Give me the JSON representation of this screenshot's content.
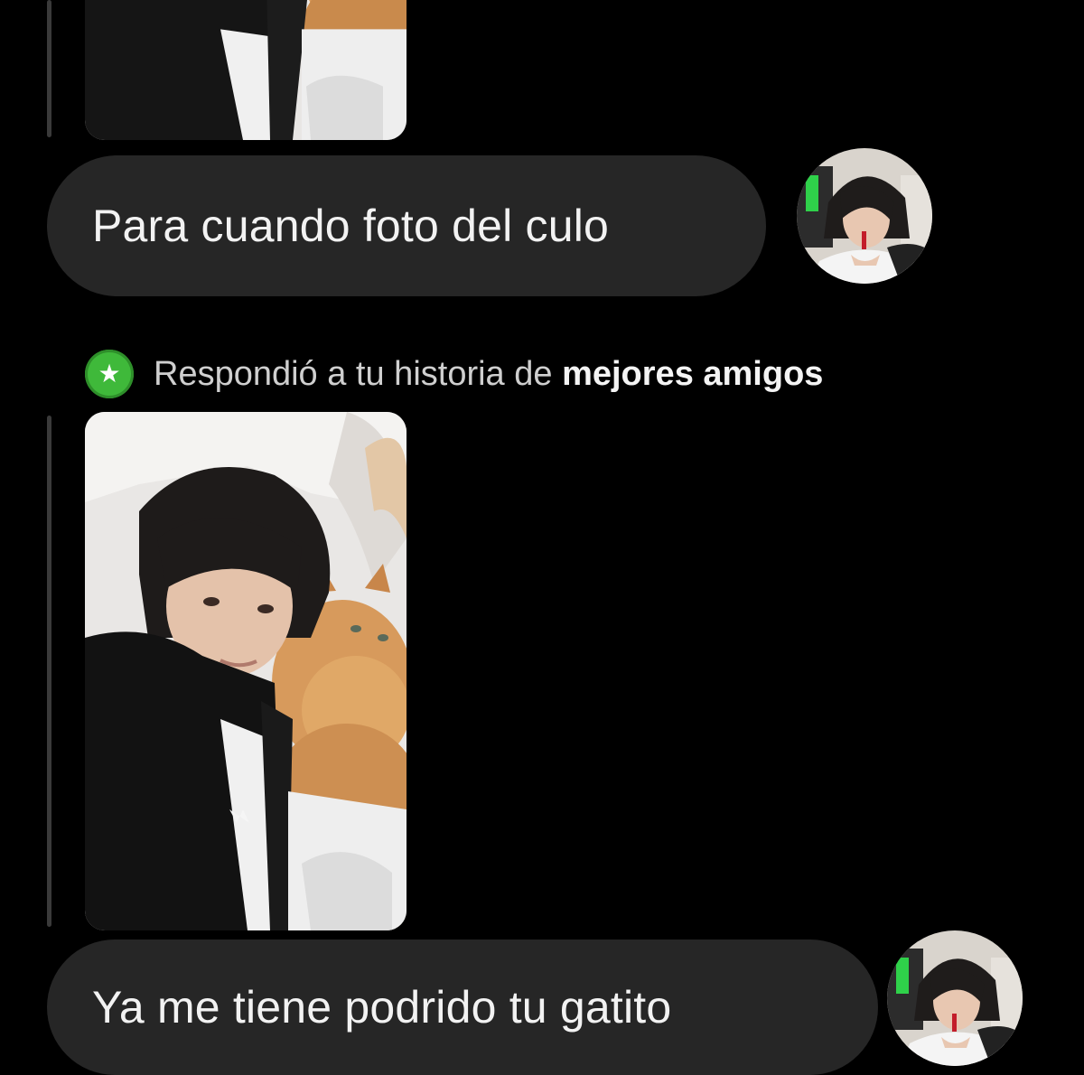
{
  "messages": [
    {
      "kind": "story_reply",
      "story_image": "story-photo-person-with-cat",
      "text": "Para cuando foto del culo",
      "avatar": "sender-avatar"
    },
    {
      "kind": "story_reply",
      "story_note": {
        "icon": "green-star-badge",
        "text_prefix": "Respondió a tu historia de ",
        "text_bold": "mejores amigos"
      },
      "story_image": "story-photo-person-with-cat",
      "text": "Ya me tiene podrido tu gatito",
      "avatar": "sender-avatar"
    }
  ],
  "colors": {
    "background": "#000000",
    "bubble": "#262626",
    "bubble_text": "#f2f2f2",
    "note_text": "#cfcfcf",
    "star_badge": "#3fb93a",
    "reply_bar": "#3a3a3a"
  }
}
